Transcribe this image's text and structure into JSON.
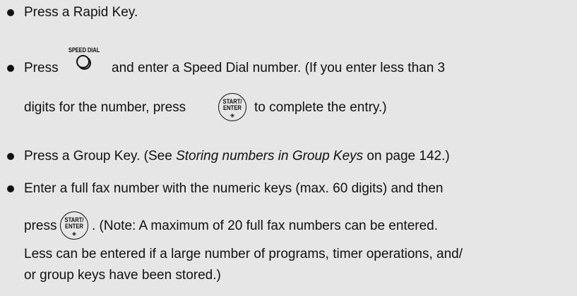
{
  "bullets": [
    {
      "text": "Press a Rapid Key."
    },
    {
      "press": "Press",
      "key_label": "SPEED DIAL",
      "after_key": "and enter a Speed Dial number. (If you enter less than 3",
      "line2_before": "digits for the number, press",
      "line2_after": "to complete the entry.)"
    },
    {
      "before": "Press a Group Key. (See ",
      "italic": "Storing numbers in Group Keys",
      "after": " on page 142.)"
    },
    {
      "line1": "Enter a full fax number with the numeric keys (max. 60 digits) and then",
      "line2_before": "press",
      "line2_after": ". (Note: A maximum of 20 full fax numbers can be entered.",
      "line3": "Less can be entered if a large number of programs, timer operations, and/",
      "line4": "or group keys have been stored.)"
    }
  ],
  "start_key": {
    "line1": "START/",
    "line2": "ENTER",
    "symbol": "◈"
  }
}
